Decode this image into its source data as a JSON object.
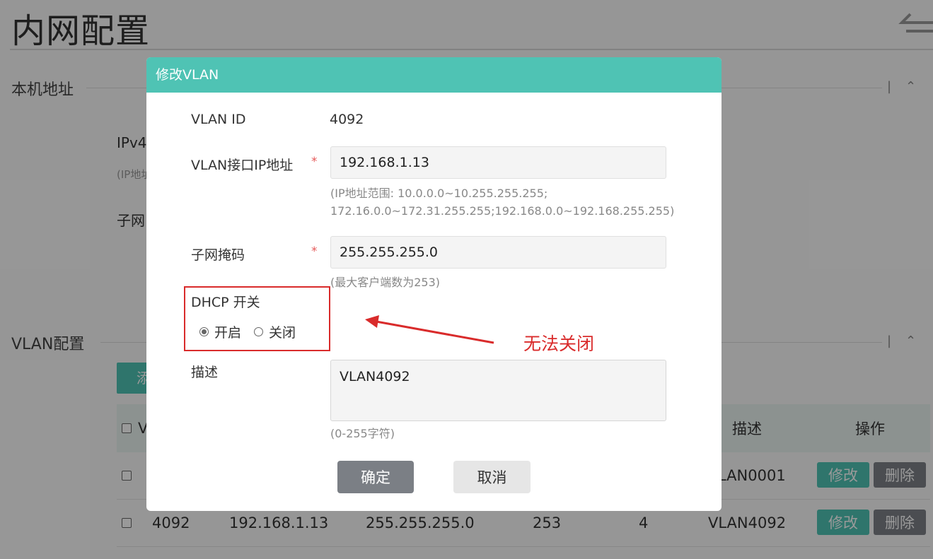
{
  "page": {
    "title": "内网配置"
  },
  "local_address": {
    "section_title": "本机地址",
    "ipv4_label": "IPv4",
    "ip_hint": "(IP地址",
    "subnet_label": "子网"
  },
  "vlan_section": {
    "section_title": "VLAN配置",
    "add_button": "添",
    "columns": {
      "vlan_id": "V",
      "description": "描述",
      "actions": "操作"
    },
    "rows": [
      {
        "id": "",
        "ip": "",
        "mask": "",
        "clients": "",
        "count": "",
        "desc": "LAN0001",
        "edit": "修改",
        "delete": "删除"
      },
      {
        "id": "4092",
        "ip": "192.168.1.13",
        "mask": "255.255.255.0",
        "clients": "253",
        "count": "4",
        "desc": "VLAN4092",
        "edit": "修改",
        "delete": "删除"
      }
    ]
  },
  "modal": {
    "title": "修改VLAN",
    "vlan_id_label": "VLAN ID",
    "vlan_id_value": "4092",
    "ip_label": "VLAN接口IP地址",
    "ip_value": "192.168.1.13",
    "ip_hint_line1": "(IP地址范围: 10.0.0.0~10.255.255.255;",
    "ip_hint_line2": "172.16.0.0~172.31.255.255;192.168.0.0~192.168.255.255)",
    "mask_label": "子网掩码",
    "mask_value": "255.255.255.0",
    "mask_hint": "(最大客户端数为253)",
    "required_mark": "*",
    "dhcp_label": "DHCP 开关",
    "dhcp_on": "开启",
    "dhcp_off": "关闭",
    "dhcp_selected": "开启",
    "desc_label": "描述",
    "desc_value": "VLAN4092",
    "desc_hint": "(0-255字符)",
    "ok_button": "确定",
    "cancel_button": "取消"
  },
  "annotation": {
    "text": "无法关闭",
    "color": "#d92b2b"
  },
  "colors": {
    "accent": "#4fc3b4",
    "delete_button": "#7d8088",
    "ok_button": "#7b7f85"
  }
}
